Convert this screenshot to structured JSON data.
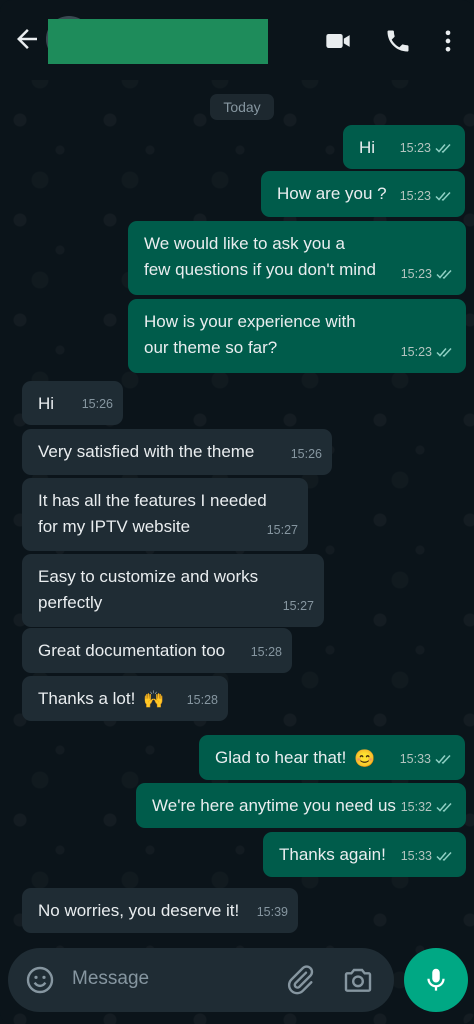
{
  "header": {
    "back_icon": "arrow-left-icon",
    "video_icon": "video-camera-icon",
    "call_icon": "phone-icon",
    "menu_icon": "more-vertical-icon"
  },
  "date_label": "Today",
  "messages": [
    {
      "dir": "out",
      "text": "Hi",
      "time": "15:23"
    },
    {
      "dir": "out",
      "text": "How are you ?",
      "time": "15:23"
    },
    {
      "dir": "out",
      "text": "We would like to ask you a\nfew questions if you don't mind",
      "time": "15:23"
    },
    {
      "dir": "out",
      "text": "How is your experience with\nour theme so far?",
      "time": "15:23"
    },
    {
      "dir": "in",
      "text": "Hi",
      "time": "15:26"
    },
    {
      "dir": "in",
      "text": "Very satisfied with the theme",
      "time": "15:26"
    },
    {
      "dir": "in",
      "text": "It has all the features I needed\nfor my IPTV website",
      "time": "15:27"
    },
    {
      "dir": "in",
      "text": "Easy to customize and works\nperfectly",
      "time": "15:27"
    },
    {
      "dir": "in",
      "text": "Great documentation too",
      "time": "15:28"
    },
    {
      "dir": "in",
      "text": "Thanks a lot!",
      "emoji": "🙌",
      "time": "15:28"
    },
    {
      "dir": "out",
      "text": "Glad to hear that!",
      "emoji": "😊",
      "time": "15:33"
    },
    {
      "dir": "out",
      "text": "We're here anytime you need us",
      "time": "15:32"
    },
    {
      "dir": "out",
      "text": "Thanks again!",
      "time": "15:33"
    },
    {
      "dir": "in",
      "text": "No worries, you deserve it!",
      "time": "15:39"
    }
  ],
  "input": {
    "placeholder": "Message",
    "emoji_icon": "smiley-icon",
    "attach_icon": "paperclip-icon",
    "camera_icon": "camera-icon",
    "mic_icon": "microphone-icon"
  },
  "colors": {
    "background": "#0b141a",
    "outgoing_bubble": "#005c4b",
    "incoming_bubble": "#1f2c34",
    "accent": "#00a884",
    "read_ticks": "#8fd0c4"
  }
}
